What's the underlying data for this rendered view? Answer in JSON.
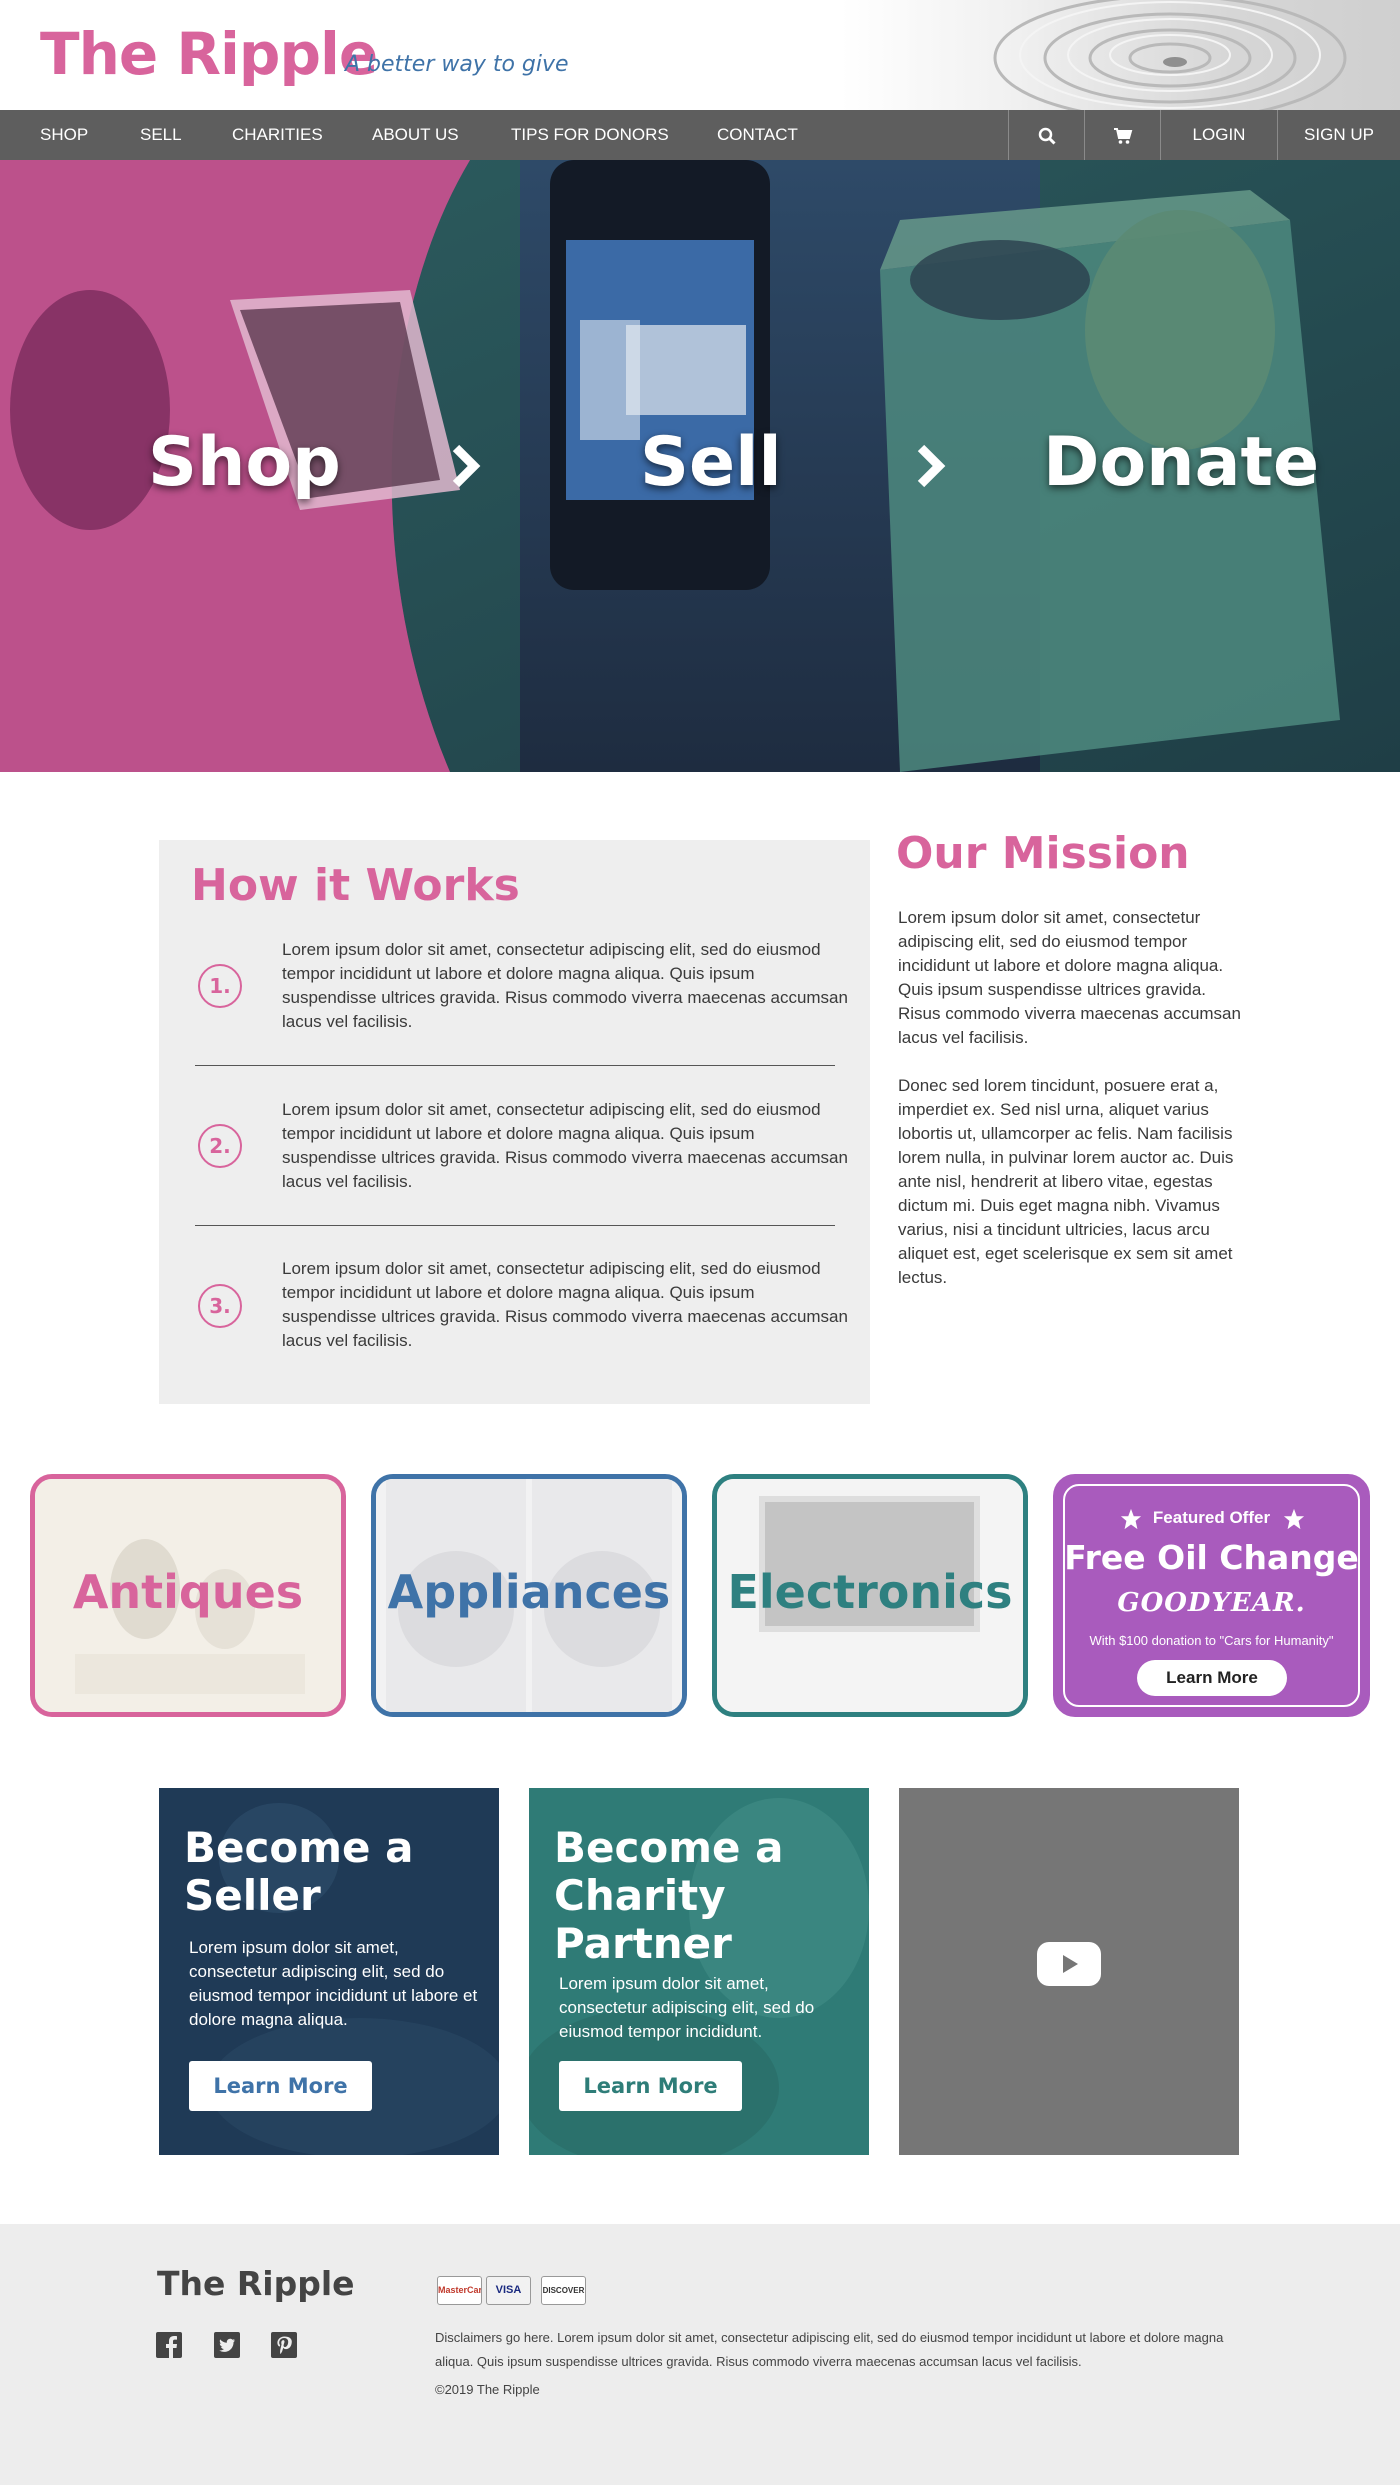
{
  "header": {
    "logo": "The Ripple",
    "tagline": "A better way to give"
  },
  "nav": {
    "items": [
      "SHOP",
      "SELL",
      "CHARITIES",
      "ABOUT US",
      "TIPS FOR DONORS",
      "CONTACT"
    ],
    "search_icon": "search-icon",
    "cart_icon": "cart-icon",
    "login": "LOGIN",
    "signup": "SIGN UP"
  },
  "hero": {
    "steps": [
      "Shop",
      "Sell",
      "Donate"
    ],
    "arrow_icon": "chevron-right-icon"
  },
  "how_it_works": {
    "title": "How it Works",
    "steps": [
      {
        "num": "1.",
        "text": "Lorem ipsum dolor sit amet, consectetur adipiscing elit, sed do eiusmod tempor incididunt ut labore et dolore magna aliqua. Quis ipsum suspendisse ultrices gravida. Risus commodo viverra maecenas accumsan lacus vel facilisis."
      },
      {
        "num": "2.",
        "text": "Lorem ipsum dolor sit amet, consectetur adipiscing elit, sed do eiusmod tempor incididunt ut labore et dolore magna aliqua. Quis ipsum suspendisse ultrices gravida. Risus commodo viverra maecenas accumsan lacus vel facilisis."
      },
      {
        "num": "3.",
        "text": "Lorem ipsum dolor sit amet, consectetur adipiscing elit, sed do eiusmod tempor incididunt ut labore et dolore magna aliqua. Quis ipsum suspendisse ultrices gravida. Risus commodo viverra maecenas accumsan lacus vel facilisis."
      }
    ]
  },
  "mission": {
    "title": "Our Mission",
    "paragraphs": [
      "Lorem ipsum dolor sit amet, consectetur adipiscing elit, sed do eiusmod tempor incididunt ut labore et dolore magna aliqua. Quis ipsum suspendisse ultrices gravida. Risus commodo viverra maecenas accumsan lacus vel facilisis.",
      "Donec sed lorem tincidunt, posuere erat a, imperdiet ex. Sed nisl urna, aliquet varius lobortis ut, ullamcorper ac felis. Nam facilisis lorem nulla, in pulvinar lorem auctor ac. Duis ante nisl, hendrerit at libero vitae, egestas dictum mi. Duis eget magna nibh. Vivamus varius, nisi a tincidunt ultricies, lacus arcu aliquet est, eget scelerisque ex sem sit amet lectus."
    ]
  },
  "categories": [
    {
      "label": "Antiques",
      "color": "#d8649c"
    },
    {
      "label": "Appliances",
      "color": "#3f73a8"
    },
    {
      "label": "Electronics",
      "color": "#2e8080"
    }
  ],
  "featured": {
    "heading": "Featured Offer",
    "title": "Free Oil Change",
    "brand": "GOODYEAR.",
    "note": "With $100 donation to \"Cars for Humanity\"",
    "button": "Learn More",
    "color": "#a95bbd"
  },
  "promos": [
    {
      "title": "Become a Seller",
      "text": "Lorem ipsum dolor sit amet, consectetur adipiscing elit, sed do eiusmod tempor incididunt ut labore et dolore magna aliqua.",
      "button": "Learn More",
      "color": "#1e3a57"
    },
    {
      "title": "Become a Charity Partner",
      "text": "Lorem ipsum dolor sit amet, consectetur adipiscing elit, sed do eiusmod tempor incididunt.",
      "button": "Learn More",
      "color": "#2e7d78"
    }
  ],
  "video": {
    "play_icon": "play-icon"
  },
  "footer": {
    "logo": "The Ripple",
    "social": [
      "facebook-icon",
      "twitter-icon",
      "pinterest-icon"
    ],
    "cards": [
      "MasterCard",
      "VISA",
      "DISCOVER"
    ],
    "disclaimer": "Disclaimers go here. Lorem ipsum dolor sit amet, consectetur adipiscing elit, sed do eiusmod tempor incididunt ut labore et dolore magna aliqua. Quis ipsum suspendisse ultrices gravida. Risus commodo viverra maecenas accumsan lacus vel facilisis.",
    "copyright": "©2019 The Ripple"
  }
}
